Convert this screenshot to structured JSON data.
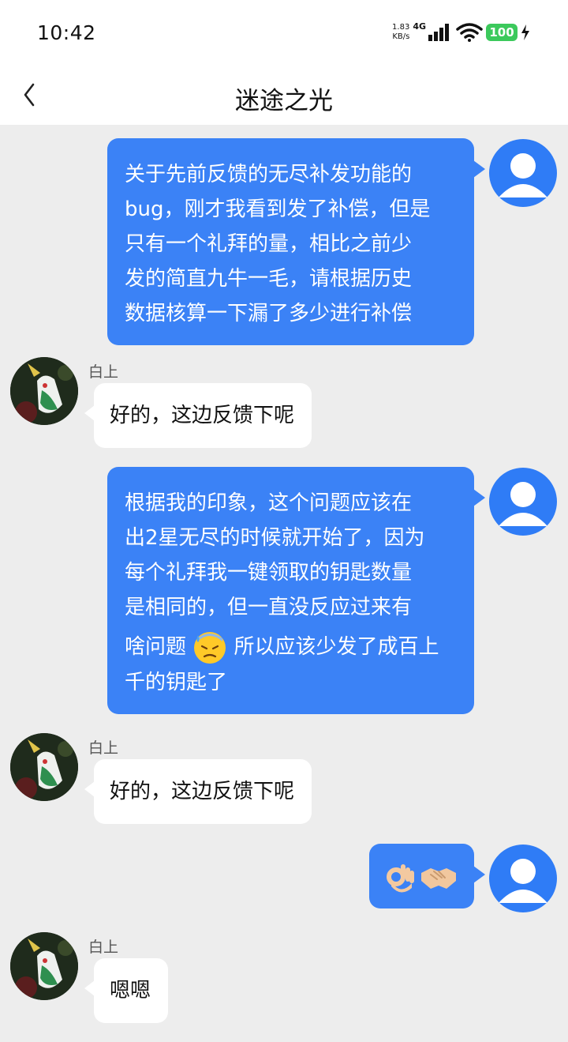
{
  "status_bar": {
    "time": "10:42",
    "net_speed_value": "1.83",
    "net_speed_unit": "KB/s",
    "net_type": "4G",
    "battery": "100",
    "icons": [
      "signal-icon",
      "wifi-icon",
      "battery-icon",
      "charging-icon"
    ]
  },
  "header": {
    "title": "迷途之光",
    "back_icon": "chevron-left-icon"
  },
  "colors": {
    "my_bubble": "#3b82f6",
    "other_bubble": "#ffffff",
    "background": "#ededed",
    "battery_green": "#3cc95c"
  },
  "messages": [
    {
      "from": "me",
      "lines": [
        "关于先前反馈的无尽补发功能的",
        "bug，刚才我看到发了补偿，但是",
        "只有一个礼拜的量，相比之前少",
        "发的简直九牛一毛，请根据历史",
        "数据核算一下漏了多少进行补偿"
      ]
    },
    {
      "from": "other",
      "sender": "白上",
      "text": "好的，这边反馈下呢"
    },
    {
      "from": "me",
      "lines": [
        "根据我的印象，这个问题应该在",
        "出2星无尽的时候就开始了，因为",
        "每个礼拜我一键领取的钥匙数量",
        "是相同的，但一直没反应过来有"
      ],
      "line5_before": "啥问题",
      "line5_emoji": "downcast-face-with-sweat-emoji",
      "line5_after": "所以应该少发了成百上",
      "line6": "千的钥匙了"
    },
    {
      "from": "other",
      "sender": "白上",
      "text": "好的，这边反馈下呢"
    },
    {
      "from": "me",
      "emojis": [
        "ok-hand-emoji",
        "handshake-emoji"
      ]
    },
    {
      "from": "other",
      "sender": "白上",
      "text": "嗯嗯"
    }
  ]
}
